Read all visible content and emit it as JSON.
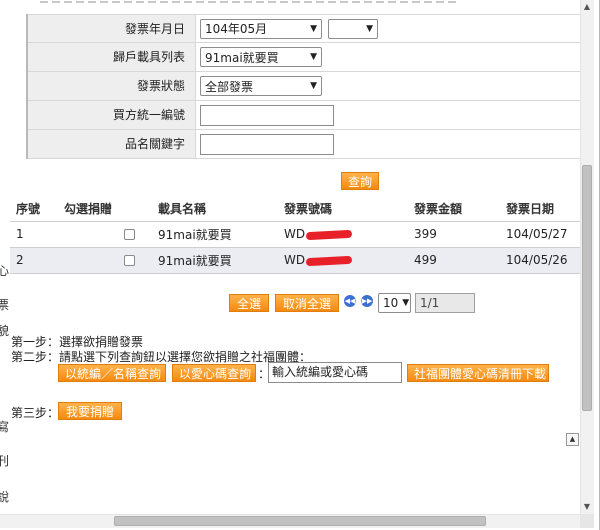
{
  "form": {
    "date_label": "發票年月日",
    "date_value": "104年05月",
    "date_day_value": "",
    "carrier_label": "歸戶載具列表",
    "carrier_value": "91mai就要買",
    "status_label": "發票狀態",
    "status_value": "全部發票",
    "buyer_id_label": "買方統一編號",
    "buyer_id_value": "",
    "keyword_label": "品名關鍵字",
    "keyword_value": "",
    "query_button": "查詢"
  },
  "table": {
    "headers": [
      "序號",
      "勾選捐贈",
      "載具名稱",
      "發票號碼",
      "發票金額",
      "發票日期"
    ],
    "rows": [
      {
        "no": "1",
        "carrier": "91mai就要買",
        "invoice_prefix": "WD",
        "amount": "399",
        "date": "104/05/27"
      },
      {
        "no": "2",
        "carrier": "91mai就要買",
        "invoice_prefix": "WD",
        "amount": "499",
        "date": "104/05/26"
      }
    ]
  },
  "pager": {
    "select_all": "全選",
    "cancel_select_all": "取消全選",
    "page_size": "10",
    "page_indicator": "1/1"
  },
  "steps": {
    "step1": "第一步：選擇欲捐贈發票",
    "step2": "第二步：請點選下列查詢鈕以選擇您欲捐贈之社福團體：",
    "search_by_name_button": "以統編／名稱查詢",
    "search_by_code_button": "以愛心碼查詢",
    "colon": "：",
    "code_input_value": "輸入統編或愛心碼",
    "download_button": "社福團體愛心碼清冊下載",
    "step3": "第三步：",
    "donate_button": "我要捐贈"
  },
  "left_clipped": [
    "心",
    "票",
    "貌",
    "寫",
    "刊",
    "說"
  ],
  "colors": {
    "orange": "#f58a10",
    "redaction": "#e8202a",
    "pager_blue": "#3c6fd0",
    "label_bg": "#eeeeee",
    "alt_row": "#ececf3"
  },
  "icons": [
    "first-page-icon",
    "next-page-icon",
    "dropdown-arrow-icon",
    "scroll-up-icon",
    "scroll-down-icon",
    "back-to-top-icon"
  ]
}
